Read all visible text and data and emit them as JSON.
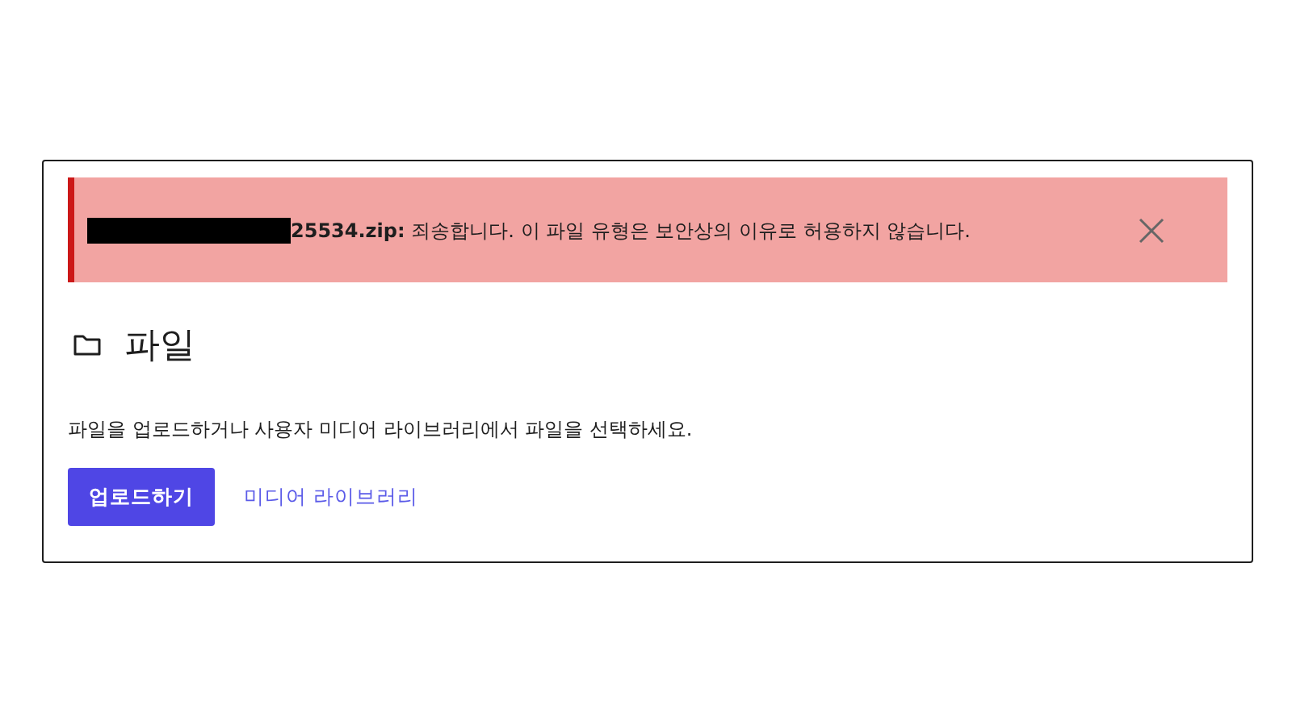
{
  "notice": {
    "filename": "25534.zip:",
    "message": "죄송합니다. 이 파일 유형은 보안상의 이유로 허용하지 않습니다.",
    "redacted": true
  },
  "panel": {
    "title": "파일",
    "description": "파일을 업로드하거나 사용자 미디어 라이브러리에서 파일을 선택하세요.",
    "upload_button": "업로드하기",
    "library_link": "미디어 라이브러리"
  }
}
